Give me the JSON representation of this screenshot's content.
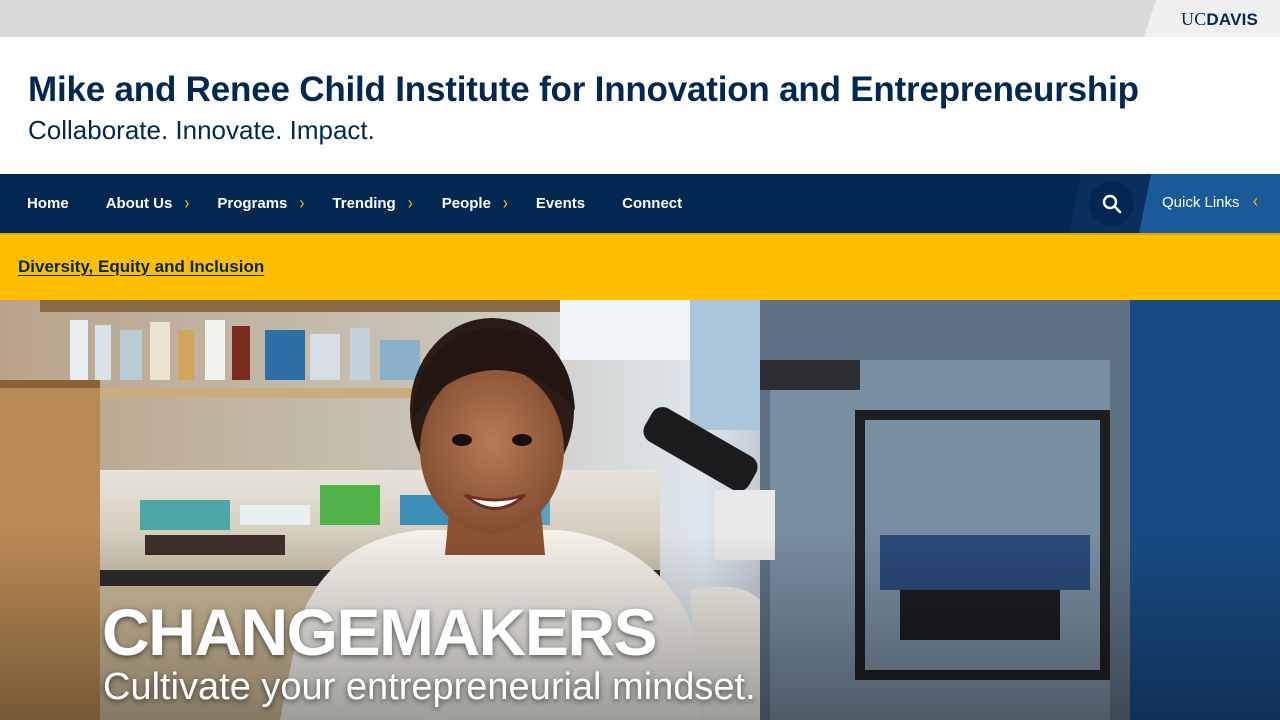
{
  "header": {
    "logo": {
      "uc": "UC",
      "davis": "DAVIS"
    }
  },
  "branding": {
    "title": "Mike and Renee Child Institute for Innovation and Entrepreneurship",
    "slogan": "Collaborate. Innovate. Impact."
  },
  "nav": {
    "items": [
      {
        "label": "Home",
        "has_submenu": false
      },
      {
        "label": "About Us",
        "has_submenu": true
      },
      {
        "label": "Programs",
        "has_submenu": true
      },
      {
        "label": "Trending",
        "has_submenu": true
      },
      {
        "label": "People",
        "has_submenu": true
      },
      {
        "label": "Events",
        "has_submenu": false
      },
      {
        "label": "Connect",
        "has_submenu": false
      }
    ],
    "search_icon": "search-icon",
    "quick_links_label": "Quick Links"
  },
  "alert": {
    "link_text": "Diversity, Equity and Inclusion"
  },
  "hero": {
    "title": "CHANGEMAKERS",
    "subtitle": "Cultivate your entrepreneurial mindset."
  },
  "colors": {
    "navy": "#022851",
    "gold": "#ffbf00",
    "quick_links_blue": "#1b5a98",
    "topbar_gray": "#dadada"
  }
}
